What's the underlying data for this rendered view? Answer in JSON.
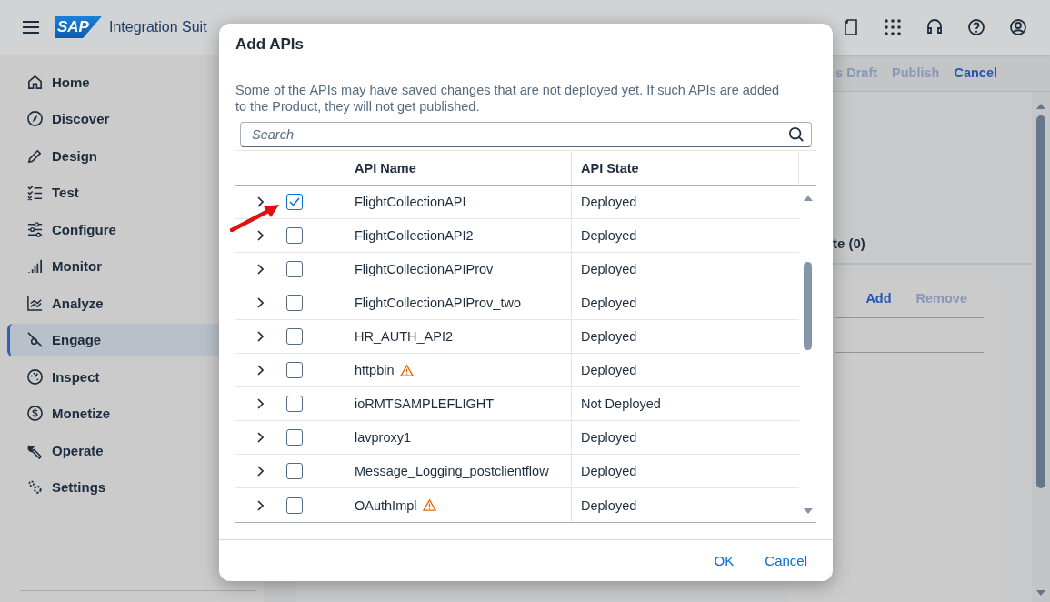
{
  "shell": {
    "logo": "SAP",
    "title": "Integration Suit"
  },
  "sidebar": {
    "items": [
      {
        "label": "Home",
        "selected": false
      },
      {
        "label": "Discover",
        "selected": false
      },
      {
        "label": "Design",
        "selected": false
      },
      {
        "label": "Test",
        "selected": false
      },
      {
        "label": "Configure",
        "selected": false
      },
      {
        "label": "Monitor",
        "selected": false
      },
      {
        "label": "Analyze",
        "selected": false
      },
      {
        "label": "Engage",
        "selected": true
      },
      {
        "label": "Inspect",
        "selected": false
      },
      {
        "label": "Monetize",
        "selected": false
      },
      {
        "label": "Operate",
        "selected": false
      },
      {
        "label": "Settings",
        "selected": false
      }
    ]
  },
  "toolbar": {
    "actions": [
      {
        "label": "s Draft",
        "disabled": true
      },
      {
        "label": "Publish",
        "disabled": true
      },
      {
        "label": "Cancel",
        "disabled": false
      }
    ]
  },
  "tab_fragment": "te (0)",
  "card": {
    "actions": [
      {
        "label": "Add",
        "disabled": false
      },
      {
        "label": "Remove",
        "disabled": true
      }
    ]
  },
  "dialog": {
    "title": "Add APIs",
    "message": "Some of the APIs may have saved changes that are not deployed yet. If such APIs are added to the Product, they will not get published.",
    "search": {
      "placeholder": "Search"
    },
    "columns": [
      "API Name",
      "API State"
    ],
    "rows": [
      {
        "name": "FlightCollectionAPI",
        "state": "Deployed",
        "checked": true,
        "warning": false,
        "expanded": false
      },
      {
        "name": "FlightCollectionAPI2",
        "state": "Deployed",
        "checked": false,
        "warning": false,
        "expanded": false
      },
      {
        "name": "FlightCollectionAPIProv",
        "state": "Deployed",
        "checked": false,
        "warning": false,
        "expanded": false
      },
      {
        "name": "FlightCollectionAPIProv_two",
        "state": "Deployed",
        "checked": false,
        "warning": false,
        "expanded": false
      },
      {
        "name": "HR_AUTH_API2",
        "state": "Deployed",
        "checked": false,
        "warning": false,
        "expanded": false
      },
      {
        "name": "httpbin",
        "state": "Deployed",
        "checked": false,
        "warning": true,
        "expanded": false
      },
      {
        "name": "ioRMTSAMPLEFLIGHT",
        "state": "Not Deployed",
        "checked": false,
        "warning": false,
        "expanded": false
      },
      {
        "name": "lavproxy1",
        "state": "Deployed",
        "checked": false,
        "warning": false,
        "expanded": false
      },
      {
        "name": "Message_Logging_postclientflow",
        "state": "Deployed",
        "checked": false,
        "warning": false,
        "expanded": false
      },
      {
        "name": "OAuthImpl",
        "state": "Deployed",
        "checked": false,
        "warning": true,
        "expanded": false
      }
    ],
    "buttons": [
      "OK",
      "Cancel"
    ]
  }
}
